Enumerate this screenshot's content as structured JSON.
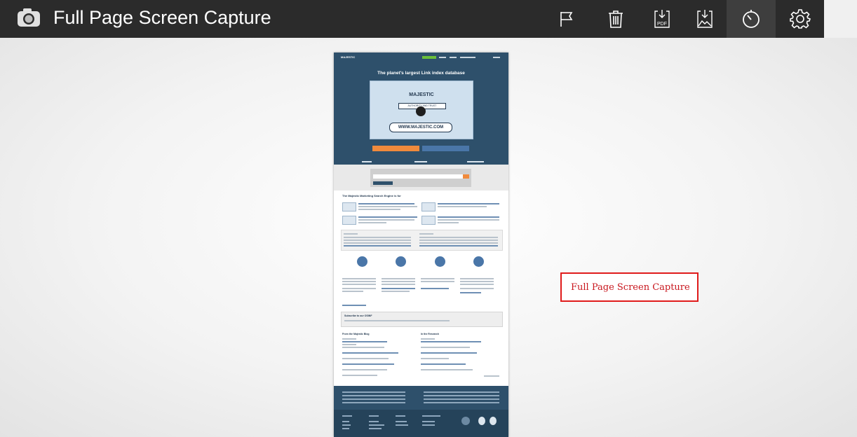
{
  "app": {
    "title": "Full Page Screen Capture",
    "icon": "camera-icon"
  },
  "toolbar": {
    "tools": [
      {
        "name": "flag-icon",
        "label": "Report"
      },
      {
        "name": "trash-icon",
        "label": "Delete"
      },
      {
        "name": "download-pdf-icon",
        "label": "PDF"
      },
      {
        "name": "download-image-icon",
        "label": "Download image"
      },
      {
        "name": "timer-icon",
        "label": "Timer"
      },
      {
        "name": "gear-icon",
        "label": "Settings"
      }
    ],
    "active_tool": "timer-icon"
  },
  "capture": {
    "logo": "MAJESTIC",
    "headline": "The planet's largest Link index database",
    "video_brand": "MAJESTIC",
    "video_ribbon": "AUTHORITY AND TRUST",
    "video_url": "WWW.MAJESTIC.COM",
    "section_title": "The Majestic Marketing Search Engine is for",
    "blog_title": "From the Majestic Blog",
    "news_title": "In the Research",
    "subscribe_title": "Subscribe to our OSINF"
  },
  "label": {
    "text": "Full Page Screen Capture"
  },
  "colors": {
    "toolbar_bg": "#2b2b2b",
    "active_tool_bg": "#3e3e3e",
    "label_border": "#e01b1b",
    "label_text": "#c8161d",
    "capture_hero": "#2e506b"
  }
}
